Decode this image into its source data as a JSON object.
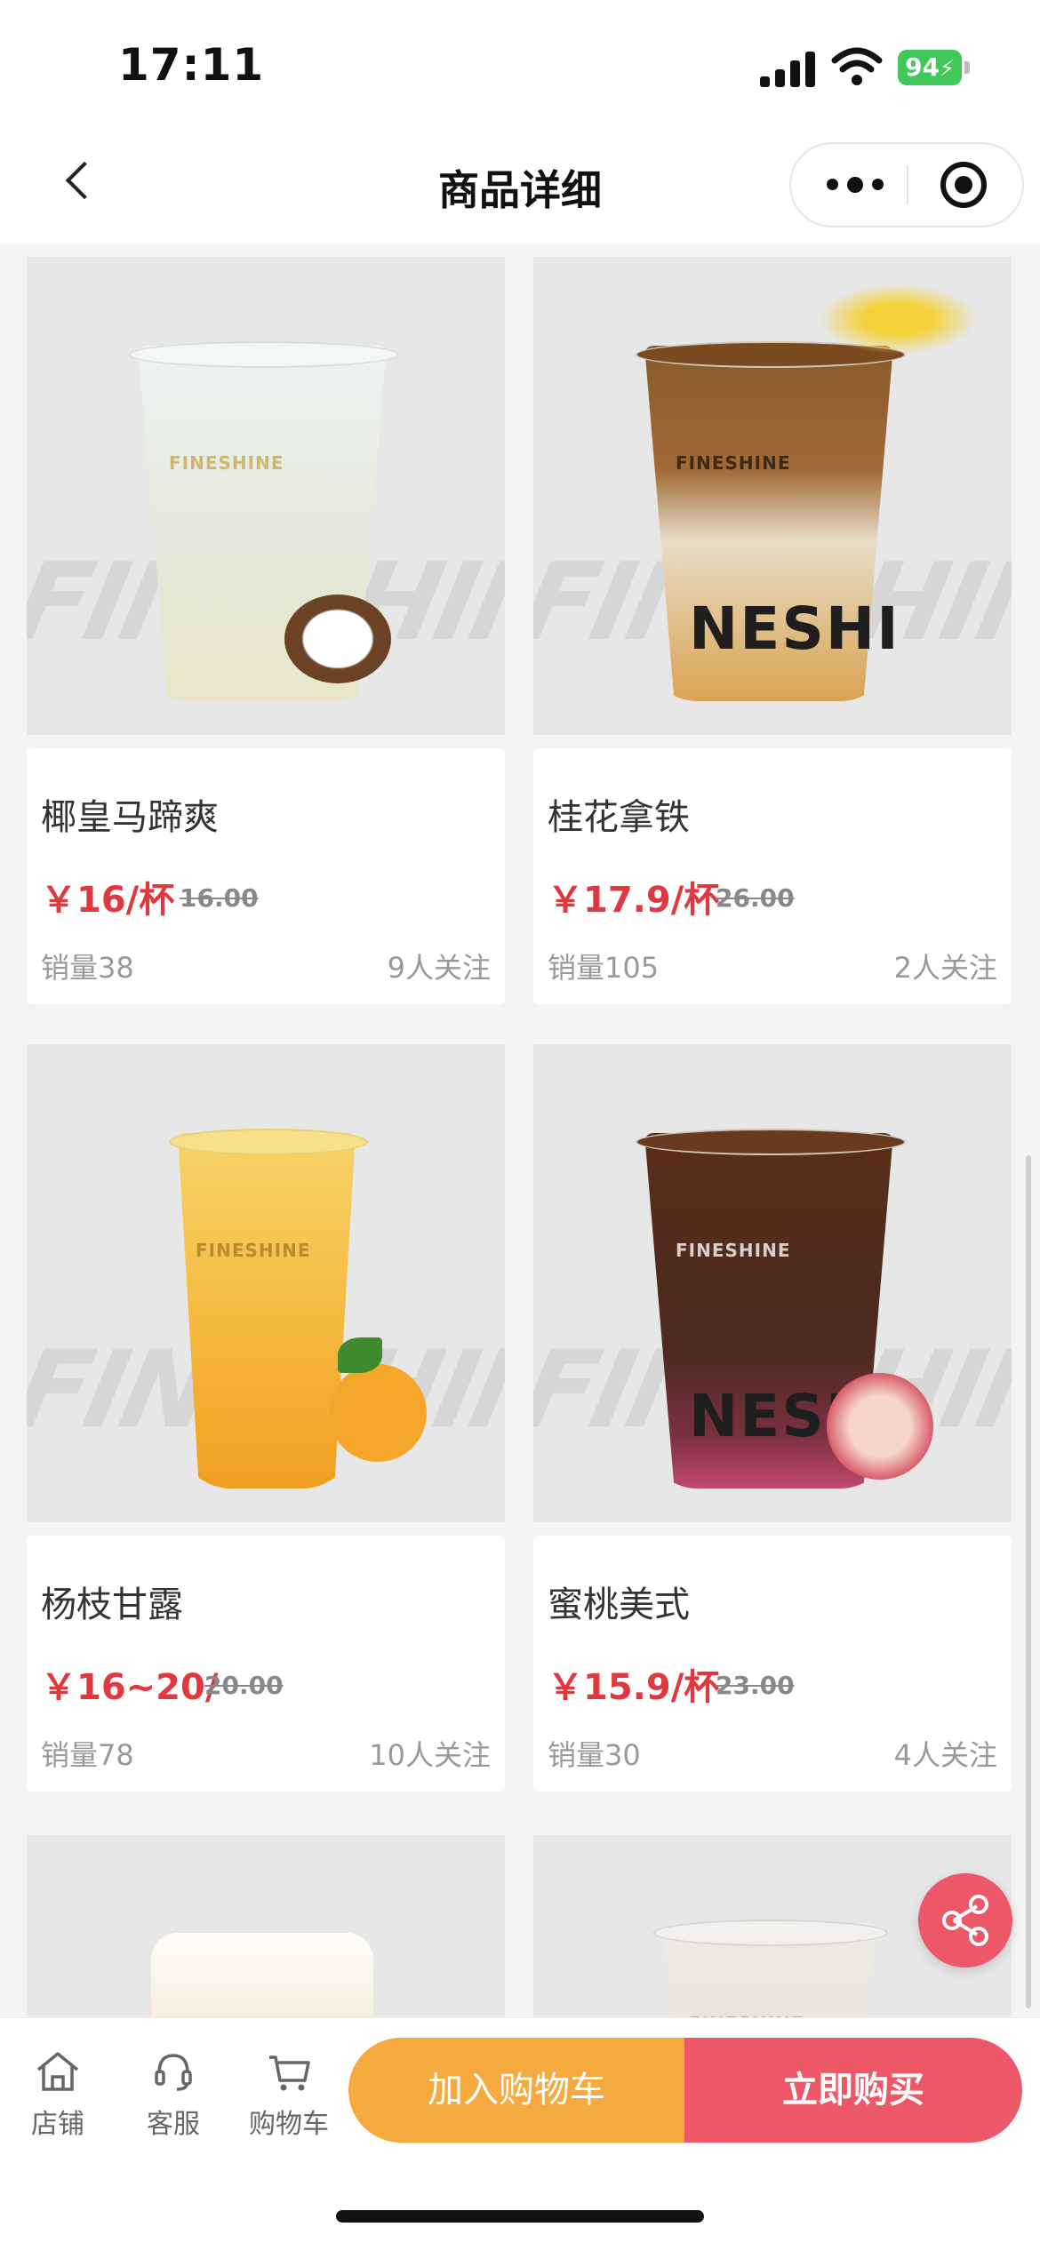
{
  "status": {
    "time": "17:11",
    "battery": "94"
  },
  "nav": {
    "title": "商品详细"
  },
  "products": [
    {
      "name": "椰皇马蹄爽",
      "price": "￥16/杯",
      "orig": "16.00",
      "sales": "销量38",
      "followers": "9人关注"
    },
    {
      "name": "桂花拿铁",
      "price": "￥17.9/杯",
      "orig": "26.00",
      "sales": "销量105",
      "followers": "2人关注"
    },
    {
      "name": "杨枝甘露",
      "price": "￥16~20/",
      "orig": "20.00",
      "sales": "销量78",
      "followers": "10人关注"
    },
    {
      "name": "蜜桃美式",
      "price": "￥15.9/杯",
      "orig": "23.00",
      "sales": "销量30",
      "followers": "4人关注"
    }
  ],
  "images": {
    "watermark": "FINESHINE",
    "cup_brand": "FINESHINE",
    "print_text": "NESHI"
  },
  "bottom": {
    "tabs": [
      {
        "label": "店铺",
        "icon": "store-icon"
      },
      {
        "label": "客服",
        "icon": "customer-service-icon"
      },
      {
        "label": "购物车",
        "icon": "cart-icon"
      }
    ],
    "add_to_cart": "加入购物车",
    "buy_now": "立即购买"
  },
  "colors": {
    "accent_red": "#e0383e",
    "orange": "#f5aa3f",
    "pink": "#ec5867"
  }
}
